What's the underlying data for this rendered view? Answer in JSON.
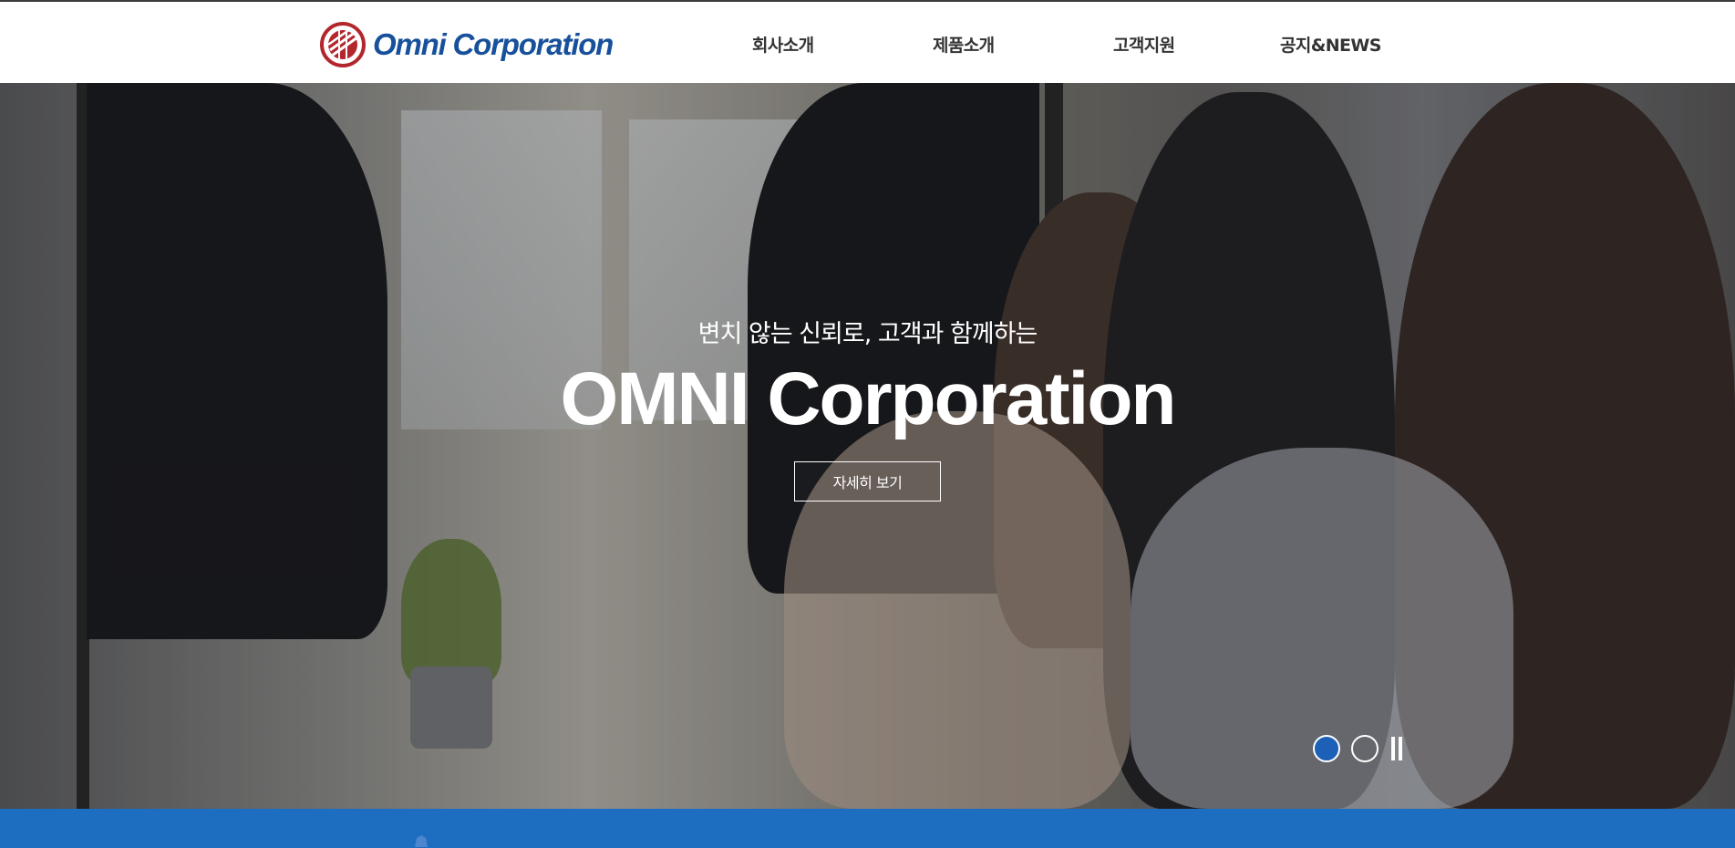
{
  "header": {
    "logo_text": "Omni Corporation",
    "logo_icon": "globe-logo-icon",
    "nav": [
      {
        "label": "회사소개"
      },
      {
        "label": "제품소개"
      },
      {
        "label": "고객지원"
      },
      {
        "label": "공지&NEWS"
      }
    ]
  },
  "hero": {
    "subtitle": "변치 않는 신뢰로, 고객과 함께하는",
    "title": "OMNI Corporation",
    "button_label": "자세히 보기",
    "slider": {
      "slide_count": 2,
      "active_index": 0,
      "pause_icon": "pause-icon"
    }
  },
  "colors": {
    "brand_blue": "#17509b",
    "logo_red": "#b3262d",
    "band_blue": "#1d6dc0",
    "active_dot": "#1c60b8"
  }
}
